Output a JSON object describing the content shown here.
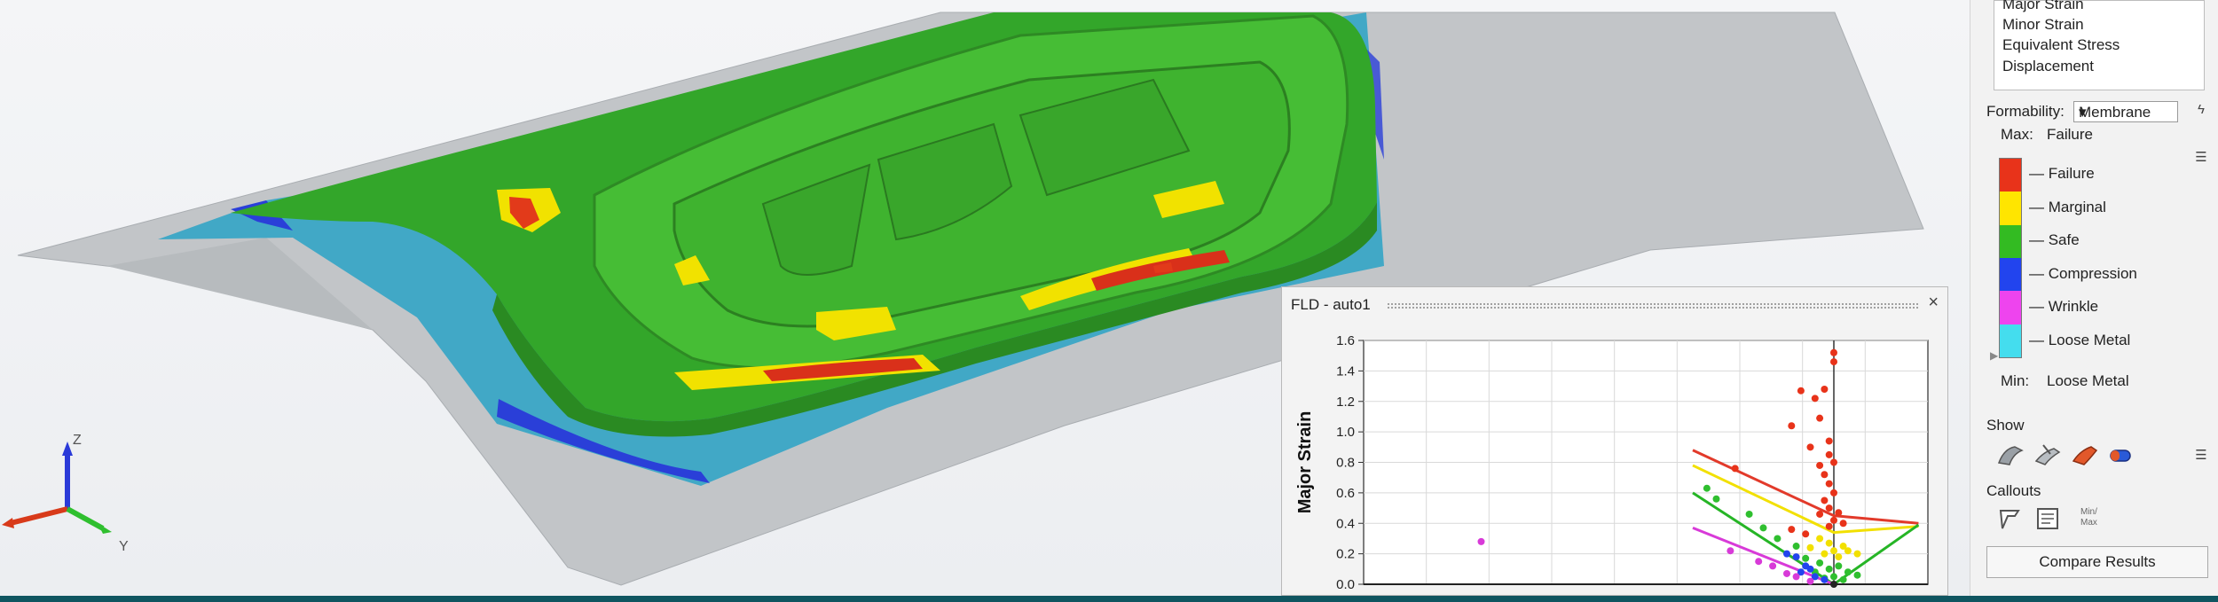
{
  "results_panel": {
    "items": [
      "Major Strain",
      "Minor Strain",
      "Equivalent Stress",
      "Displacement"
    ]
  },
  "formability": {
    "label": "Formability:",
    "selected": "Membrane",
    "max_label": "Max:",
    "max_value": "Failure",
    "min_label": "Min:",
    "min_value": "Loose Metal",
    "legend": [
      {
        "label": "— Failure",
        "color": "#e8331a"
      },
      {
        "label": "— Marginal",
        "color": "#ffe500"
      },
      {
        "label": "— Safe",
        "color": "#33bb22"
      },
      {
        "label": "— Compression",
        "color": "#2244ee"
      },
      {
        "label": "— Wrinkle",
        "color": "#ee44ee"
      },
      {
        "label": "— Loose Metal",
        "color": "#44ddee"
      }
    ]
  },
  "show": {
    "label": "Show"
  },
  "callouts": {
    "label": "Callouts",
    "minmax_label_1": "Min/",
    "minmax_label_2": "Max"
  },
  "compare_button": "Compare Results",
  "fld_window": {
    "title": "FLD - auto1",
    "close": "×"
  },
  "axes_icon": {
    "z": "Z",
    "y": "Y"
  },
  "chart_data": {
    "type": "scatter",
    "ylabel": "Major Strain",
    "xlabel": "",
    "ylim": [
      0.0,
      1.6
    ],
    "yticks": [
      "0.0",
      "0.2",
      "0.4",
      "0.6",
      "0.8",
      "1.0",
      "1.2",
      "1.4",
      "1.6"
    ],
    "xlim": [
      -1.0,
      0.2
    ],
    "grid": true,
    "curves": [
      {
        "color": "#e23a2a",
        "points": [
          [
            -0.3,
            0.88
          ],
          [
            0.0,
            0.45
          ],
          [
            0.18,
            0.4
          ]
        ]
      },
      {
        "color": "#f2e000",
        "points": [
          [
            -0.3,
            0.78
          ],
          [
            0.0,
            0.34
          ],
          [
            0.18,
            0.38
          ]
        ]
      },
      {
        "color": "#26b526",
        "points": [
          [
            -0.3,
            0.6
          ],
          [
            0.0,
            0.0
          ],
          [
            0.18,
            0.39
          ]
        ]
      },
      {
        "color": "#d83ad8",
        "points": [
          [
            -0.3,
            0.37
          ],
          [
            0.0,
            0.0
          ]
        ]
      }
    ],
    "series": [
      {
        "color": "#e8331a",
        "points": [
          [
            -0.07,
            1.27
          ],
          [
            -0.04,
            1.22
          ],
          [
            -0.09,
            1.04
          ],
          [
            -0.03,
            1.09
          ],
          [
            -0.02,
            1.28
          ],
          [
            0.0,
            1.52
          ],
          [
            0.0,
            1.46
          ],
          [
            -0.05,
            0.9
          ],
          [
            -0.01,
            0.94
          ],
          [
            -0.21,
            0.76
          ],
          [
            -0.03,
            0.78
          ],
          [
            -0.01,
            0.85
          ],
          [
            0.0,
            0.8
          ],
          [
            -0.02,
            0.72
          ],
          [
            -0.01,
            0.66
          ],
          [
            0.0,
            0.6
          ],
          [
            -0.02,
            0.55
          ],
          [
            -0.01,
            0.5
          ],
          [
            0.01,
            0.47
          ],
          [
            -0.03,
            0.46
          ],
          [
            0.0,
            0.42
          ],
          [
            -0.01,
            0.38
          ],
          [
            0.02,
            0.4
          ],
          [
            -0.09,
            0.36
          ],
          [
            -0.06,
            0.33
          ]
        ]
      },
      {
        "color": "#f2e000",
        "points": [
          [
            -0.03,
            0.3
          ],
          [
            -0.01,
            0.27
          ],
          [
            0.02,
            0.25
          ],
          [
            0.03,
            0.22
          ],
          [
            -0.05,
            0.24
          ],
          [
            0.0,
            0.22
          ],
          [
            0.05,
            0.2
          ],
          [
            -0.02,
            0.2
          ],
          [
            0.01,
            0.18
          ]
        ]
      },
      {
        "color": "#2fbf2f",
        "points": [
          [
            -0.27,
            0.63
          ],
          [
            -0.25,
            0.56
          ],
          [
            -0.18,
            0.46
          ],
          [
            -0.15,
            0.37
          ],
          [
            -0.12,
            0.3
          ],
          [
            -0.08,
            0.25
          ],
          [
            -0.06,
            0.17
          ],
          [
            -0.03,
            0.14
          ],
          [
            -0.01,
            0.1
          ],
          [
            0.01,
            0.12
          ],
          [
            0.03,
            0.08
          ],
          [
            0.05,
            0.06
          ],
          [
            -0.04,
            0.08
          ],
          [
            0.0,
            0.05
          ],
          [
            0.02,
            0.03
          ],
          [
            -0.02,
            0.04
          ]
        ]
      },
      {
        "color": "#2244ee",
        "points": [
          [
            -0.1,
            0.2
          ],
          [
            -0.08,
            0.18
          ],
          [
            -0.06,
            0.12
          ],
          [
            -0.05,
            0.1
          ],
          [
            -0.07,
            0.08
          ],
          [
            -0.04,
            0.05
          ],
          [
            -0.02,
            0.03
          ]
        ]
      },
      {
        "color": "#d83ad8",
        "points": [
          [
            -0.75,
            0.28
          ],
          [
            -0.22,
            0.22
          ],
          [
            -0.16,
            0.15
          ],
          [
            -0.13,
            0.12
          ],
          [
            -0.1,
            0.07
          ],
          [
            -0.08,
            0.05
          ],
          [
            -0.05,
            0.02
          ]
        ]
      },
      {
        "color": "#222222",
        "points": [
          [
            0.0,
            0.0
          ]
        ]
      }
    ]
  }
}
